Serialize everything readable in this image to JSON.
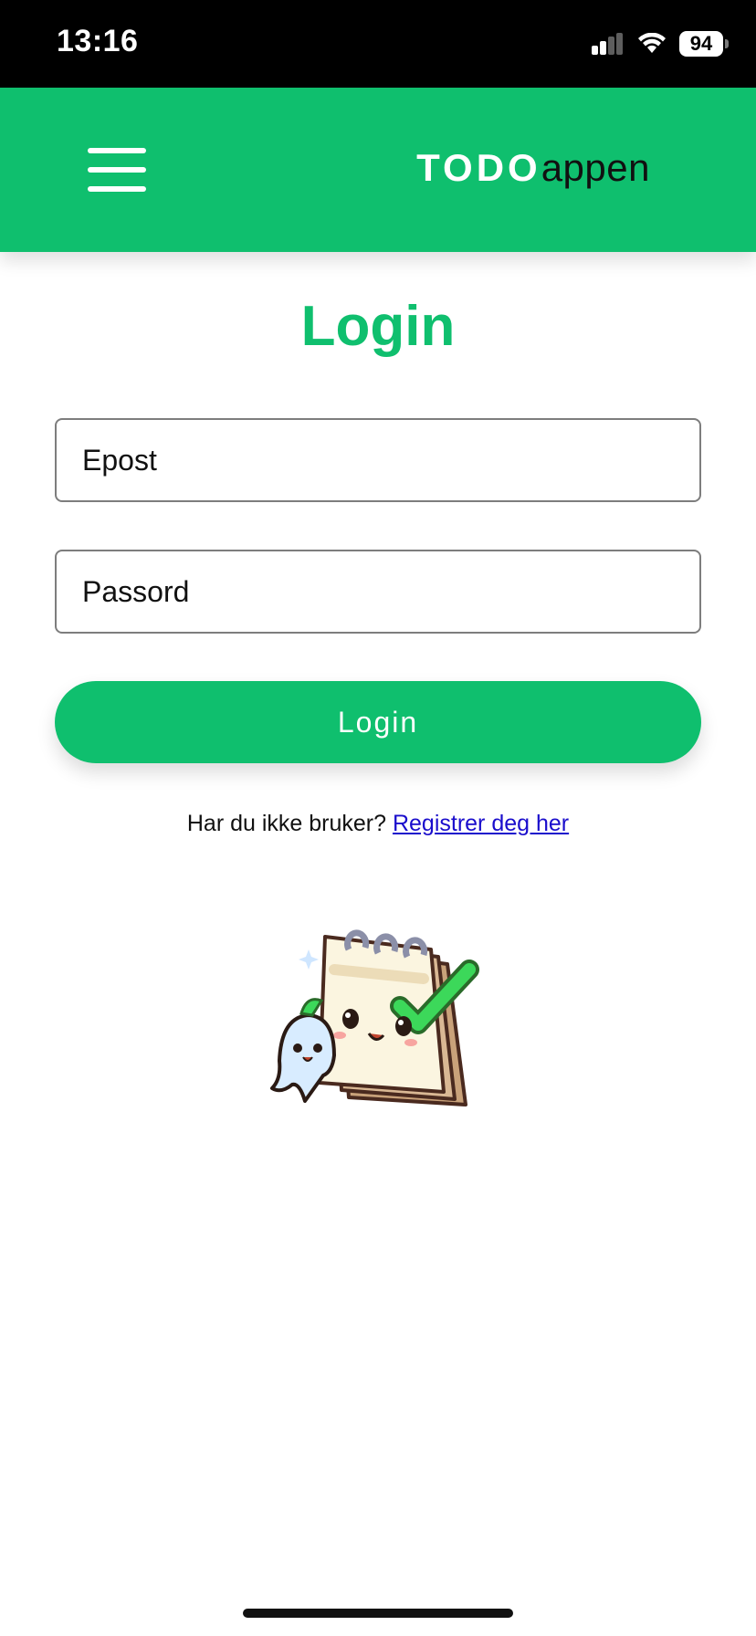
{
  "status_bar": {
    "time": "13:16",
    "battery": "94",
    "icons": [
      "signal-icon",
      "wifi-icon",
      "battery-icon"
    ]
  },
  "header": {
    "brand_bold": "TODO",
    "brand_light": "appen",
    "menu_icon": "hamburger-menu-icon",
    "background_color": "#0fbf6e"
  },
  "login": {
    "title": "Login",
    "email_placeholder": "Epost",
    "email_value": "",
    "password_placeholder": "Passord",
    "password_value": "",
    "submit_label": "Login",
    "register_prompt": "Har du ikke bruker?",
    "register_link": "Registrer deg her"
  },
  "illustration": {
    "icon": "notepad-mascot-illustration"
  },
  "colors": {
    "accent": "#0fbf6e",
    "link": "#1a0dcc"
  }
}
